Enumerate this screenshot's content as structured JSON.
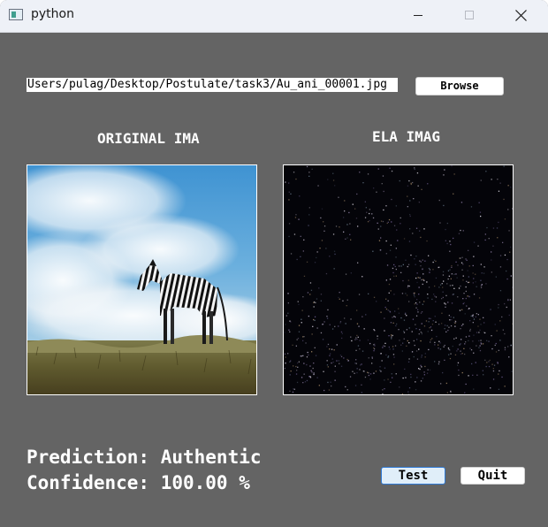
{
  "window": {
    "title": "python",
    "icon": "python-app-icon"
  },
  "file": {
    "path_value": "Users/pulag/Desktop/Postulate/task3/Au_ani_00001.jpg",
    "browse_label": "Browse"
  },
  "panels": {
    "original_title": "ORIGINAL IMA",
    "ela_title": "ELA IMAG"
  },
  "result": {
    "prediction_label": "Prediction: Authentic",
    "confidence_label": "Confidence: 100.00 %"
  },
  "buttons": {
    "test_label": "Test",
    "quit_label": "Quit"
  },
  "colors": {
    "background": "#646464",
    "titlebar": "#eef1f7",
    "focus_border": "#2f7ad6"
  }
}
